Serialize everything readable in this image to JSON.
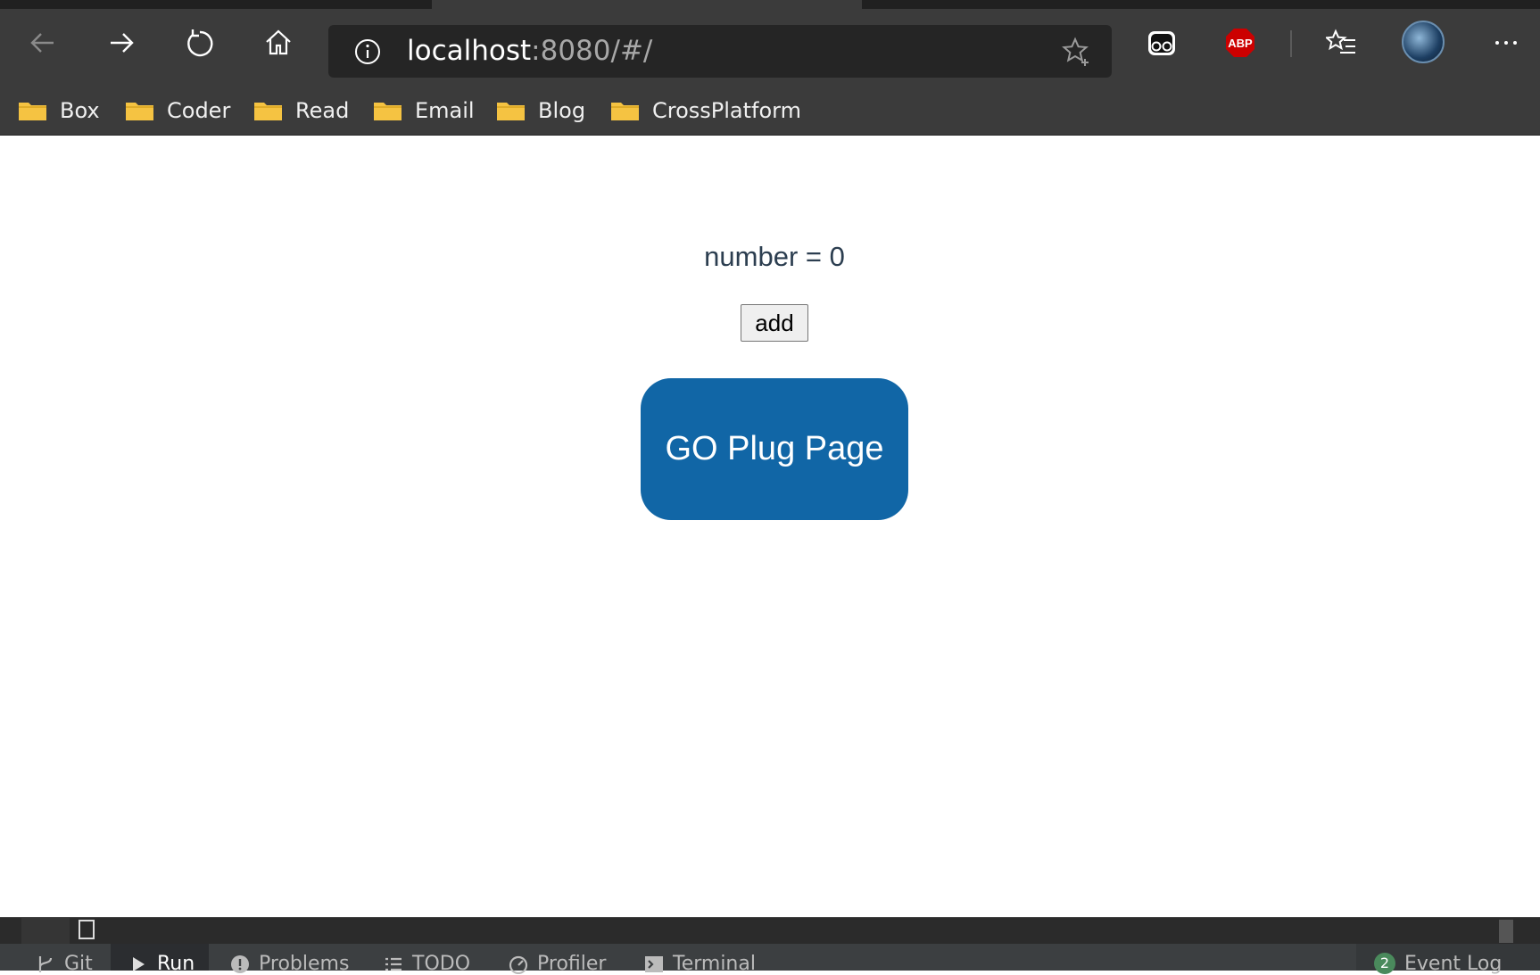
{
  "browser": {
    "address": {
      "host": "localhost",
      "path": ":8080/#/"
    },
    "bookmarks": [
      "Box",
      "Coder",
      "Read",
      "Email",
      "Blog",
      "CrossPlatform"
    ],
    "extensions": {
      "adblock_label": "ABP"
    }
  },
  "page": {
    "number_text": "number = 0",
    "add_label": "add",
    "go_label": "GO Plug Page"
  },
  "ide": {
    "tabs": [
      "Git",
      "Run",
      "Problems",
      "TODO",
      "Profiler",
      "Terminal"
    ],
    "event_log": {
      "count": "2",
      "label": "Event Log"
    }
  },
  "colors": {
    "chrome": "#3b3b3b",
    "go_button": "#1166a6",
    "folder": "#f5c342",
    "abp": "#cc0000"
  }
}
